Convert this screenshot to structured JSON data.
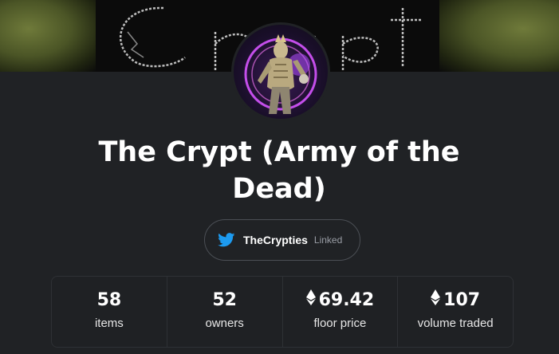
{
  "collection": {
    "title": "The Crypt (Army of the Dead)"
  },
  "social": {
    "handle": "TheCrypties",
    "status": "Linked",
    "icon": "twitter-icon",
    "icon_color": "#1d9bf0"
  },
  "stats": [
    {
      "value": "58",
      "label": "items",
      "currency_icon": ""
    },
    {
      "value": "52",
      "label": "owners",
      "currency_icon": ""
    },
    {
      "value": "69.42",
      "label": "floor price",
      "currency_icon": "ethereum-icon"
    },
    {
      "value": "107",
      "label": "volume traded",
      "currency_icon": "ethereum-icon"
    }
  ],
  "colors": {
    "background": "#202225",
    "text": "#ffffff",
    "muted": "#9a9ea6",
    "avatar_glow": "#c040ff"
  }
}
